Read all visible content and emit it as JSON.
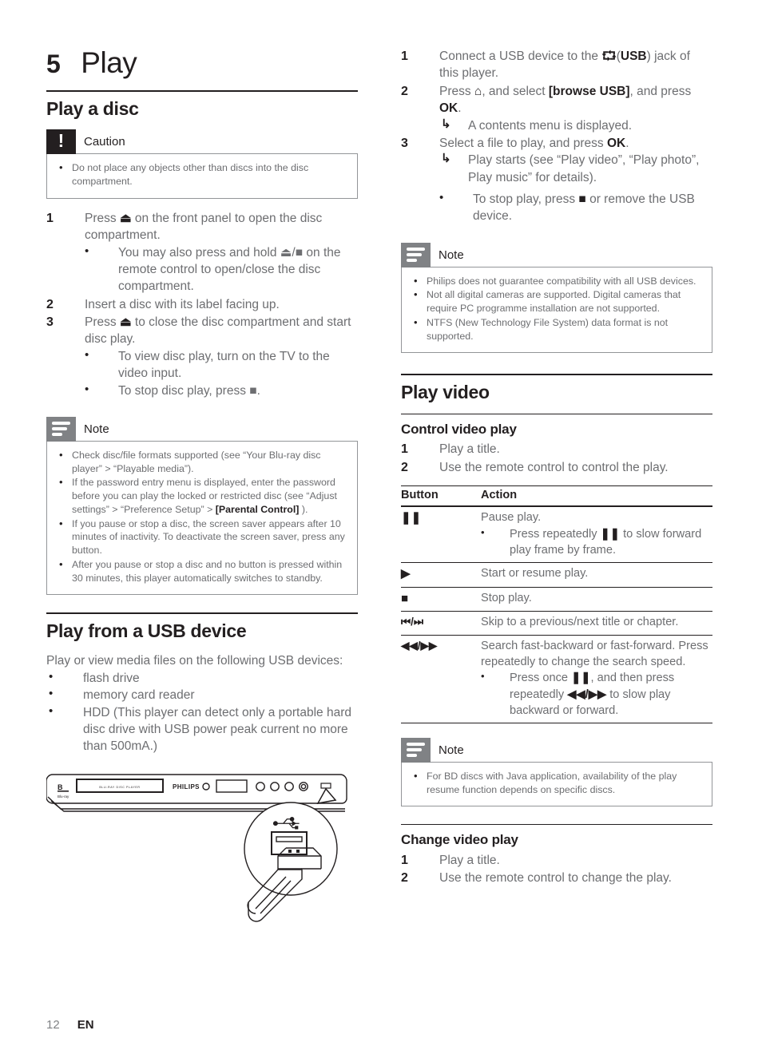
{
  "chapter": {
    "number": "5",
    "title": "Play"
  },
  "footer": {
    "page": "12",
    "lang": "EN"
  },
  "left": {
    "section_title": "Play a disc",
    "caution": {
      "label": "Caution",
      "icon": "exclamation-icon",
      "items": [
        "Do not place any objects other than discs into the disc compartment."
      ]
    },
    "steps": [
      {
        "num": "1",
        "text_a": "Press ",
        "sym": "⏏",
        "text_b": " on the front panel to open the disc compartment."
      },
      {
        "num": "2",
        "text": "Insert a disc with its label facing up."
      },
      {
        "num": "3",
        "text_a": "Press ",
        "sym": "⏏",
        "text_b": " to close the disc compartment and start disc play."
      }
    ],
    "step1_sub": [
      "You may also press and hold ⏏/■ on the remote control to open/close the disc compartment."
    ],
    "step3_sub": [
      "To view disc play, turn on the TV to the video input.",
      "To stop disc play, press ■."
    ],
    "note": {
      "label": "Note",
      "icon": "note-lines-icon",
      "items": [
        "Check disc/file formats supported (see “Your Blu-ray disc player” > “Playable media”).",
        "If the password entry menu is displayed, enter the password before you can play the locked or restricted disc (see “Adjust settings” > “Preference Setup” > [Parental Control] ).",
        "If you pause or stop a disc, the screen saver appears after 10 minutes of inactivity. To deactivate the screen saver, press any button.",
        "After you pause or stop a disc and no button is pressed within 30 minutes, this player automatically switches to standby."
      ],
      "item2_pre": "If the password entry menu is displayed, enter the password before you can play the locked or restricted disc (see “Adjust settings” > “Preference Setup” > ",
      "item2_bold": "[Parental Control]",
      "item2_post": " )."
    },
    "usb_section_title": "Play from a USB device",
    "usb_intro": "Play or view media files on the following USB devices:",
    "usb_devices": [
      "flash drive",
      "memory card reader",
      "HDD (This player can detect only a portable hard disc drive with USB power peak current no more than 500mA.)"
    ],
    "illustration": {
      "brand": "PHILIPS",
      "disc_label": "BLU-RAY DISC PLAYER",
      "bluray_logo": "Blu-ray Disc",
      "usb_label": "USB"
    }
  },
  "right": {
    "usb_steps": [
      {
        "num": "1",
        "pre": "Connect a USB device to the ",
        "sym": "⮔",
        "mid": "(",
        "bold": "USB",
        "post": ") jack of this player."
      },
      {
        "num": "2",
        "pre": "Press ",
        "sym": "⌂",
        "mid": ", and select ",
        "bold": "[browse USB]",
        "post": ", and press ",
        "bold2": "OK",
        "post2": "."
      },
      {
        "num": "3",
        "pre": "Select a file to play, and press ",
        "bold": "OK",
        "post": "."
      }
    ],
    "step2_arrow": [
      "A contents menu is displayed."
    ],
    "step3_arrow": [
      "Play starts (see “Play video”, “Play photo”, Play music” for details)."
    ],
    "step3_bullet_pre": "To stop play, press ",
    "step3_bullet_sym": "■",
    "step3_bullet_post": " or remove the USB device.",
    "note_usb": {
      "label": "Note",
      "icon": "note-lines-icon",
      "items": [
        "Philips does not guarantee compatibility with all USB devices.",
        "Not all digital cameras are supported. Digital cameras that require PC programme installation are not supported.",
        "NTFS (New Technology File System) data format is not supported."
      ]
    },
    "video_section_title": "Play video",
    "control_heading": "Control video play",
    "control_steps": [
      {
        "num": "1",
        "text": "Play a title."
      },
      {
        "num": "2",
        "text": "Use the remote control to control the play."
      }
    ],
    "table": {
      "headers": [
        "Button",
        "Action"
      ],
      "rows": [
        {
          "button": "❚❚",
          "action": "Pause play.",
          "sub_pre": "Press repeatedly ",
          "sub_sym": "❚❚",
          "sub_post": " to slow forward play frame by frame."
        },
        {
          "button": "▶",
          "action": "Start or resume play."
        },
        {
          "button": "■",
          "action": "Stop play."
        },
        {
          "button": "⏮/⏭",
          "action": "Skip to a previous/next title or chapter."
        },
        {
          "button": "◀◀/▶▶",
          "action": "Search fast-backward or fast-forward. Press repeatedly to change the search speed.",
          "sub_pre": "Press once ",
          "sub_sym": "❚❚",
          "sub_mid": ", and then press repeatedly ",
          "sub_sym2": "◀◀/▶▶",
          "sub_post": " to slow play backward or forward."
        }
      ]
    },
    "note_bd": {
      "label": "Note",
      "icon": "note-lines-icon",
      "items": [
        "For BD discs with Java application, availability of the play resume function depends on specific discs."
      ]
    },
    "change_heading": "Change video play",
    "change_steps": [
      {
        "num": "1",
        "text": "Play a title."
      },
      {
        "num": "2",
        "text": "Use the remote control to change the play."
      }
    ]
  }
}
